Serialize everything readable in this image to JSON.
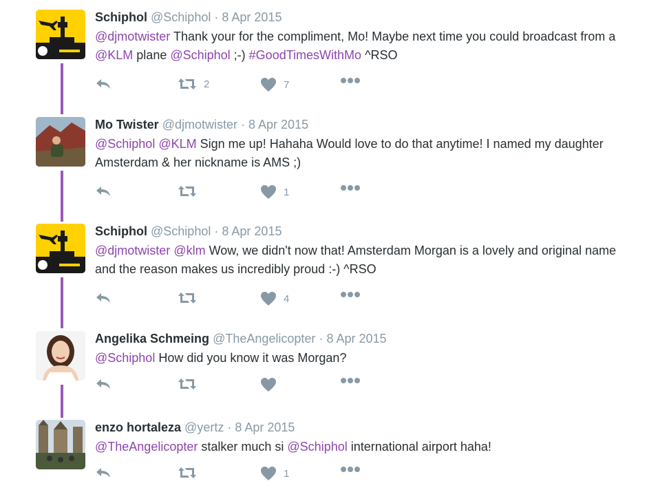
{
  "colors": {
    "link": "#8e44ad",
    "thread": "#9b59b6",
    "meta": "#8899a6"
  },
  "tweets": [
    {
      "name": "Schiphol",
      "handle": "@Schiphol",
      "sep": "·",
      "date": "8 Apr 2015",
      "avatar": "schiphol-logo",
      "text_parts": [
        {
          "t": "@djmotwister",
          "link": true
        },
        {
          "t": " Thank your for the compliment, Mo! Maybe next time you could broadcast from a ",
          "link": false
        },
        {
          "t": "@KLM",
          "link": true
        },
        {
          "t": " plane ",
          "link": false
        },
        {
          "t": "@Schiphol",
          "link": true
        },
        {
          "t": " ;-) ",
          "link": false
        },
        {
          "t": "#GoodTimesWithMo",
          "link": true
        },
        {
          "t": " ^RSO",
          "link": false
        }
      ],
      "retweets": "2",
      "likes": "7"
    },
    {
      "name": "Mo Twister",
      "handle": "@djmotwister",
      "sep": "·",
      "date": "8 Apr 2015",
      "avatar": "user-photo-mountain",
      "text_parts": [
        {
          "t": "@Schiphol",
          "link": true
        },
        {
          "t": " ",
          "link": false
        },
        {
          "t": "@KLM",
          "link": true
        },
        {
          "t": " Sign me up! Hahaha Would love to do that anytime! I named my daughter Amsterdam & her nickname is AMS ;)",
          "link": false
        }
      ],
      "retweets": "",
      "likes": "1"
    },
    {
      "name": "Schiphol",
      "handle": "@Schiphol",
      "sep": "·",
      "date": "8 Apr 2015",
      "avatar": "schiphol-logo",
      "text_parts": [
        {
          "t": "@djmotwister",
          "link": true
        },
        {
          "t": " ",
          "link": false
        },
        {
          "t": "@klm",
          "link": true
        },
        {
          "t": " Wow, we didn't now that! Amsterdam Morgan is a lovely and original name and the reason makes us incredibly proud :-) ^RSO",
          "link": false
        }
      ],
      "retweets": "",
      "likes": "4"
    },
    {
      "name": "Angelika Schmeing",
      "handle": "@TheAngelicopter",
      "sep": "·",
      "date": "8 Apr 2015",
      "avatar": "user-photo-portrait",
      "text_parts": [
        {
          "t": "@Schiphol",
          "link": true
        },
        {
          "t": " How did you know it was Morgan?",
          "link": false
        }
      ],
      "retweets": "",
      "likes": ""
    },
    {
      "name": "enzo hortaleza",
      "handle": "@yertz",
      "sep": "·",
      "date": "8 Apr 2015",
      "avatar": "user-photo-castle",
      "text_parts": [
        {
          "t": "@TheAngelicopter",
          "link": true
        },
        {
          "t": " stalker much si ",
          "link": false
        },
        {
          "t": "@Schiphol",
          "link": true
        },
        {
          "t": " international airport haha!",
          "link": false
        }
      ],
      "retweets": "",
      "likes": "1"
    }
  ]
}
